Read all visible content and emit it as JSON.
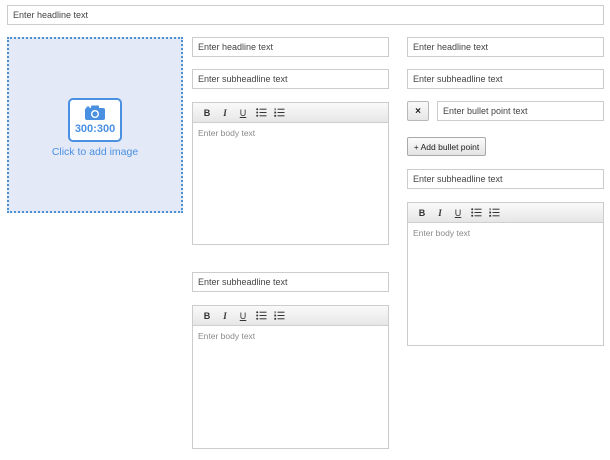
{
  "headline_main": {
    "placeholder": "Enter headline text"
  },
  "image_upload": {
    "size_label": "300:300",
    "caption": "Click to add image",
    "accent": "#4a90e2",
    "background": "#e4e9f7"
  },
  "middle": {
    "headline": {
      "placeholder": "Enter headline text"
    },
    "subheadline1": {
      "placeholder": "Enter subheadline text"
    },
    "editor1": {
      "toolbar": [
        "B",
        "I",
        "U",
        "bulleted-list-icon",
        "numbered-list-icon"
      ],
      "placeholder": "Enter body text"
    },
    "subheadline2": {
      "placeholder": "Enter subheadline text"
    },
    "editor2": {
      "toolbar": [
        "B",
        "I",
        "U",
        "bulleted-list-icon",
        "numbered-list-icon"
      ],
      "placeholder": "Enter body text"
    }
  },
  "right": {
    "headline": {
      "placeholder": "Enter headline text"
    },
    "subheadline1": {
      "placeholder": "Enter subheadline text"
    },
    "bullet": {
      "remove_label": "×",
      "placeholder": "Enter bullet point text"
    },
    "add_bullet_label": "+ Add bullet point",
    "subheadline2": {
      "placeholder": "Enter subheadline text"
    },
    "editor": {
      "toolbar": [
        "B",
        "I",
        "U",
        "bulleted-list-icon",
        "numbered-list-icon"
      ],
      "placeholder": "Enter body text"
    }
  }
}
